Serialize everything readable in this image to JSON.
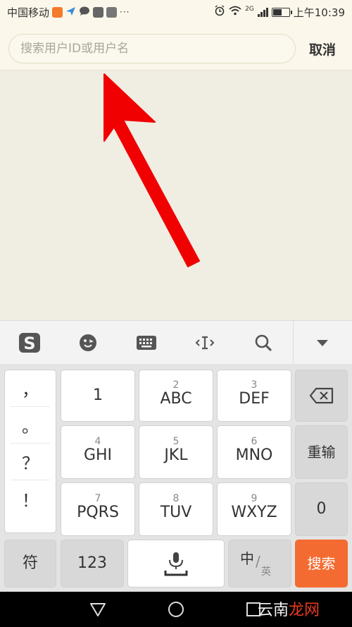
{
  "status_bar": {
    "carrier": "中国移动",
    "dots": "···",
    "network": "2G",
    "time": "上午10:39"
  },
  "search": {
    "placeholder": "搜索用户ID或用户名",
    "cancel_label": "取消"
  },
  "colors": {
    "arrow": "#f00000",
    "search_key": "#f46b31",
    "header_bg": "#fbf7ea",
    "content_bg": "#f0ede3"
  },
  "keyboard": {
    "toolbar": [
      "sogou-logo-icon",
      "emoji-icon",
      "keyboard-icon",
      "cursor-icon",
      "search-icon",
      "collapse-icon"
    ],
    "punctuation": [
      "，",
      "。",
      "？",
      "！"
    ],
    "keys": [
      {
        "num": "",
        "label": "1"
      },
      {
        "num": "2",
        "label": "ABC"
      },
      {
        "num": "3",
        "label": "DEF"
      },
      {
        "num": "4",
        "label": "GHI"
      },
      {
        "num": "5",
        "label": "JKL"
      },
      {
        "num": "6",
        "label": "MNO"
      },
      {
        "num": "7",
        "label": "PQRS"
      },
      {
        "num": "8",
        "label": "TUV"
      },
      {
        "num": "9",
        "label": "WXYZ"
      }
    ],
    "reenter_label": "重输",
    "zero_label": "0",
    "symbol_label": "符",
    "numeric_label": "123",
    "lang_primary": "中",
    "lang_secondary": "英",
    "search_label": "搜索"
  },
  "watermark": {
    "part1": "云南",
    "part2": "龙网"
  }
}
